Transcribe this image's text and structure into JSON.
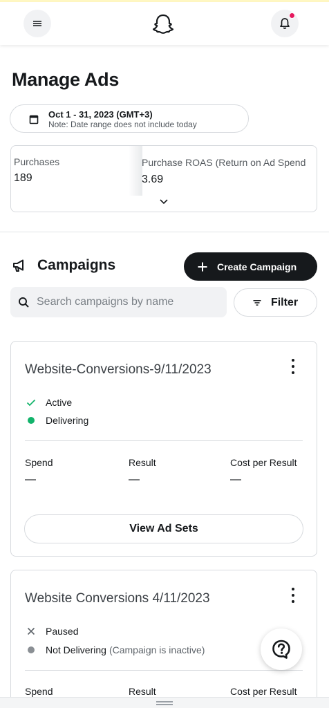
{
  "header": {
    "menu_icon": "hamburger-icon",
    "logo_icon": "ghost-logo-icon",
    "notification_icon": "bell-icon",
    "notification_dot_color": "#e5195e"
  },
  "page": {
    "title": "Manage Ads"
  },
  "date_range": {
    "label": "Oct 1 - 31, 2023 (GMT+3)",
    "note": "Note: Date range does not include today"
  },
  "metrics": [
    {
      "label": "Purchases",
      "value": "189"
    },
    {
      "label": "Purchase ROAS (Return on Ad Spend",
      "value": "3.69"
    }
  ],
  "campaigns_section": {
    "title": "Campaigns",
    "create_button": "Create Campaign",
    "search_placeholder": "Search campaigns by name",
    "filter_button": "Filter"
  },
  "campaigns": [
    {
      "name": "Website-Conversions-9/11/2023",
      "status": "Active",
      "delivery": "Delivering",
      "delivery_note": "",
      "columns": {
        "spend_label": "Spend",
        "result_label": "Result",
        "cpr_label": "Cost per Result"
      },
      "values": {
        "spend": "—",
        "result": "—",
        "cpr": "—"
      },
      "action": "View Ad Sets"
    },
    {
      "name": "Website Conversions 4/11/2023",
      "status": "Paused",
      "delivery": "Not Delivering",
      "delivery_note": "(Campaign is inactive)",
      "columns": {
        "spend_label": "Spend",
        "result_label": "Result",
        "cpr_label": "Cost per Result"
      }
    }
  ],
  "colors": {
    "primary_button": "#16191c",
    "active_green": "#12b36b",
    "inactive_gray": "#8a8f94"
  }
}
